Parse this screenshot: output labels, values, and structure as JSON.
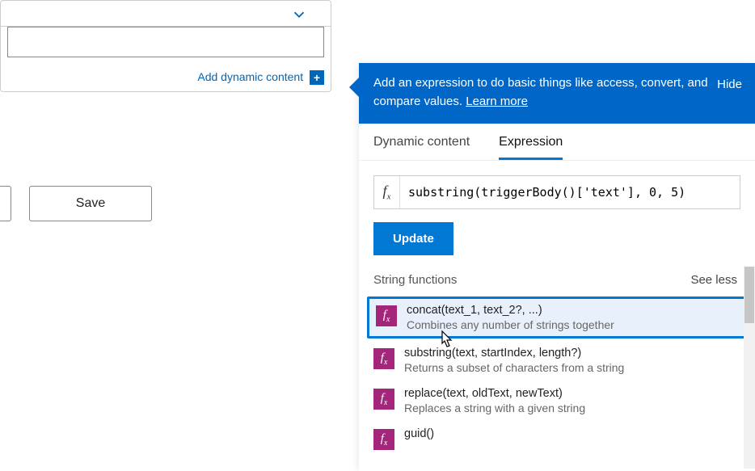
{
  "left": {
    "add_dynamic_content": "Add dynamic content",
    "save_label": "Save"
  },
  "panel": {
    "header_text": "Add an expression to do basic things like access, convert, and compare values. ",
    "learn_more": "Learn more",
    "hide": "Hide",
    "tabs": {
      "dynamic": "Dynamic content",
      "expression": "Expression"
    },
    "fx_label": "fx",
    "expression_value": "substring(triggerBody()['text'], 0, 5)",
    "update_label": "Update",
    "section_title": "String functions",
    "see_less": "See less",
    "functions": [
      {
        "sig": "concat(text_1, text_2?, ...)",
        "desc": "Combines any number of strings together",
        "selected": true
      },
      {
        "sig": "substring(text, startIndex, length?)",
        "desc": "Returns a subset of characters from a string",
        "selected": false
      },
      {
        "sig": "replace(text, oldText, newText)",
        "desc": "Replaces a string with a given string",
        "selected": false
      },
      {
        "sig": "guid()",
        "desc": "",
        "selected": false
      }
    ]
  }
}
